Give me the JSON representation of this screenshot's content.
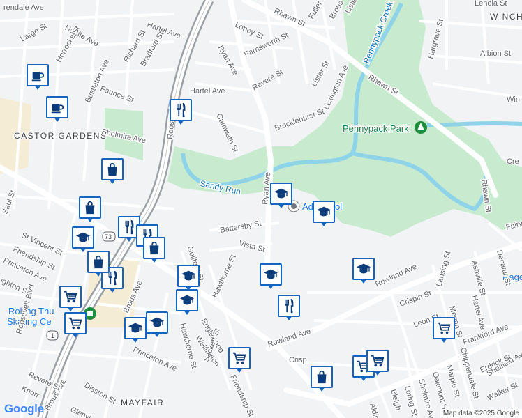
{
  "map": {
    "neighborhoods": [
      "CASTOR GARDENS",
      "MAYFAIR",
      "WINCH"
    ],
    "park": "Pennypack Park",
    "waterways": [
      "Sandy Run",
      "Pennypack Creek"
    ],
    "poi": "Ad school",
    "poi_rink": [
      "Rolling Thu",
      "Skating Ce"
    ],
    "route_shields": [
      "73",
      "1"
    ],
    "partial_label_right": "Rage",
    "streets": {
      "rendale_ave": "rendale Ave",
      "hartel_ave_top": "Hartel Ave",
      "large_st": "Large St",
      "napfle_ave": "Napfle Ave",
      "horrocks_st": "Horrocks St",
      "bustleton_ave": "Bustleton Ave",
      "faunce_st": "Faunce St",
      "richard_st": "Richard St",
      "bradford_st": "Bradford St",
      "roosevelt": "Roosevelt",
      "ryan_ave_top": "Ryan Ave",
      "loney_st": "Loney St",
      "rhawn_st_top": "Rhawn St",
      "fuller_st": "Fuller St",
      "brous_top": "Brous",
      "lister_top": "Lister",
      "farnsworth_st": "Farnsworth St",
      "revere_st_top": "Revere St",
      "hartel_ave_mid": "Hartel Ave",
      "lister_st": "Lister St",
      "lexington_ave": "Lexington Ave",
      "rhawn_st_mid": "Rhawn St",
      "camwath_st": "Camwath St",
      "brocklehurst_st": "Brocklehurst St",
      "shelmire_ave": "Shelmire Ave",
      "hargrave_st": "Hargrave St",
      "albion_st": "Albion St",
      "lenola_st": "Lenola St",
      "rhawn_st_right": "Rhawn St",
      "ryan_ave_mid": "Ryan Ave",
      "battersby_st": "Battersby St",
      "vista_st": "Vista St",
      "st_vincent_st": "St Vincent St",
      "friendship_st": "Friendship St",
      "princeton_ave": "Princeton Ave",
      "ighton_st": "ighton St",
      "saul_st": "Saul St",
      "guilford_st": "Guilford St",
      "hawthorne_st_top": "Hawthorne St",
      "brous_ave": "Brous Ave",
      "rowland_ave": "Rowland Ave",
      "rowland_ave_right": "Rowland Ave",
      "crispin_st": "Crispin St",
      "lansing_st": "Lansing St",
      "ashville_st": "Ashville St",
      "decatur_st": "Decatur St",
      "hartel_ave_right": "Hartel Ave",
      "leon_st": "Leon St",
      "megan_st": "Megan St",
      "frankford_ave": "Frankford Ave",
      "hawthorne_st_bot": "Hawthorne St",
      "englewood": "Englewood",
      "wellington": "Wellington",
      "sackett_st": "Sackett St",
      "friendship_st_bot": "Friendship St",
      "princeton_ave_bot": "Princeton Ave",
      "disston_st": "Disston St",
      "brous_ave_bot": "Brous Ave",
      "revere_st_bot": "Revere St",
      "knorr": "Knorr",
      "glenvi": "Glenvi",
      "roosevelt_blvd": "Roosevelt Blvd",
      "sheffield_ave": "Sheffield Ave",
      "erdrick_st": "Erdrick St",
      "walker_st": "Walker St",
      "chippendale_st": "Chippendale St",
      "marple_st": "Marple St",
      "oakmont_st": "Oakmont St",
      "shelmire_ave_bot": "Shelmire Ave",
      "bleigh": "Bleigh",
      "loring_st": "Loring St",
      "aldine": "Aldine",
      "cre": "Cre",
      "fairv": "Fairv",
      "win": "Win",
      "crispin_bot": "Crisp",
      "ryan_ave": "Ryan Ave"
    }
  },
  "markers": [
    {
      "type": "cafe",
      "icon": "coffee-cup-icon"
    },
    {
      "type": "cafe",
      "icon": "coffee-cup-icon"
    },
    {
      "type": "restaurant",
      "icon": "fork-knife-icon"
    },
    {
      "type": "shopping",
      "icon": "shopping-bag-icon"
    },
    {
      "type": "shopping",
      "icon": "shopping-bag-icon"
    },
    {
      "type": "school",
      "icon": "graduation-cap-icon"
    },
    {
      "type": "school",
      "icon": "graduation-cap-icon"
    },
    {
      "type": "school",
      "icon": "graduation-cap-icon"
    },
    {
      "type": "school",
      "icon": "graduation-cap-icon"
    },
    {
      "type": "school",
      "icon": "graduation-cap-icon"
    },
    {
      "type": "school",
      "icon": "graduation-cap-icon"
    },
    {
      "type": "school",
      "icon": "graduation-cap-icon"
    },
    {
      "type": "school",
      "icon": "graduation-cap-icon"
    },
    {
      "type": "school",
      "icon": "graduation-cap-icon"
    },
    {
      "type": "restaurant",
      "icon": "fork-knife-icon"
    },
    {
      "type": "restaurant",
      "icon": "fork-knife-icon"
    },
    {
      "type": "restaurant",
      "icon": "fork-knife-icon"
    },
    {
      "type": "shopping",
      "icon": "shopping-bag-icon"
    },
    {
      "type": "shopping",
      "icon": "shopping-bag-icon"
    },
    {
      "type": "grocery",
      "icon": "shopping-cart-icon"
    },
    {
      "type": "grocery",
      "icon": "shopping-cart-icon"
    },
    {
      "type": "grocery",
      "icon": "shopping-cart-icon"
    },
    {
      "type": "grocery",
      "icon": "shopping-cart-icon"
    },
    {
      "type": "grocery",
      "icon": "shopping-cart-icon"
    },
    {
      "type": "shopping",
      "icon": "shopping-bag-icon"
    },
    {
      "type": "restaurant",
      "icon": "fork-knife-icon"
    },
    {
      "type": "grocery",
      "icon": "shopping-cart-icon"
    }
  ],
  "footer": {
    "logo": "Google",
    "attribution": "Map data ©2025 Google"
  },
  "colors": {
    "park": "#c8ebd0",
    "water": "#8fd3e8",
    "marker_border": "#1565c0",
    "road_major": "#ffffff",
    "background": "#f1f3f4",
    "highway": "#9aa0a6"
  }
}
